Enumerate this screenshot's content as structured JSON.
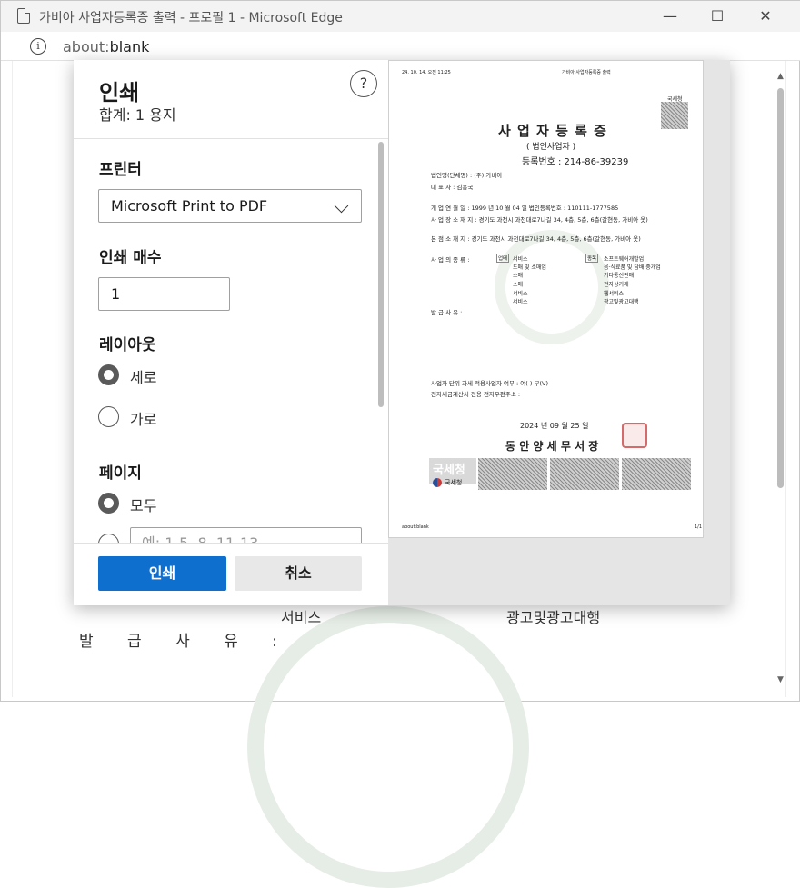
{
  "window": {
    "title": "가비아 사업자등록증 출력 - 프로필 1 - Microsoft Edge",
    "controls": {
      "minimize": "—",
      "maximize": "☐",
      "close": "✕"
    }
  },
  "address_bar": {
    "scheme": "about:",
    "host": "blank"
  },
  "background_page": {
    "cell1": "서비스",
    "cell2": "광고및광고대행",
    "reason_label": "발 급 사 유 :"
  },
  "print_dialog": {
    "title": "인쇄",
    "subtitle": "합계: 1 용지",
    "help": "?",
    "printer_label": "프린터",
    "printer_value": "Microsoft Print to PDF",
    "copies_label": "인쇄 매수",
    "copies_value": "1",
    "layout_label": "레이아웃",
    "layout_options": [
      {
        "label": "세로",
        "selected": true
      },
      {
        "label": "가로",
        "selected": false
      }
    ],
    "pages_label": "페이지",
    "pages_options": [
      {
        "label": "모두",
        "selected": true
      }
    ],
    "pages_placeholder": "예: 1-5, 8, 11-13",
    "print_button": "인쇄",
    "cancel_button": "취소"
  },
  "preview": {
    "header_left": "24. 10. 14. 오전 11:25",
    "header_center": "가비아 사업자등록증 출력",
    "nts_mark": "국세청",
    "doc_title": "사 업 자 등 록 증",
    "doc_subtitle": "( 법인사업자 )",
    "reg_no": "등록번호 : 214-86-39239",
    "rows": [
      "법인명(단체명) : (주) 가비아",
      "대        표        자 : 김홍국",
      "개  업  연  월  일 : 1999 년 10 월 04 일       법인등록번호 : 110111-1777585",
      "사 업 장  소 재 지 : 경기도 과천시 과천대로7나길 34, 4층, 5층, 6층(갈현동, 가비아 옷)",
      "본  점  소  재  지 : 경기도 과천시 과천대로7나길 34, 4층, 5층, 6층(갈현동, 가비아 옷)"
    ],
    "biz_type_label": "사 업 의  종 류 :",
    "biz_tag1": "업태",
    "biz_tag2": "종목",
    "biz_left": [
      "서비스",
      "도매 및 소매업",
      "소매",
      "소매",
      "서비스",
      "서비스"
    ],
    "biz_right": [
      "소프트웨어개발업",
      "음·식료품 및 담배 중개업",
      "기타통신판매",
      "전자상거래",
      "웹서비스",
      "광고및광고대행"
    ],
    "reason_label": "발    급    사    유 :",
    "tax_line1": "사업자 단위 과세 적용사업자 여부 : 여( ) 부(V)",
    "tax_line2": "전자세금계산서 전용 전자우편주소 :",
    "date": "2024 년 09 월 25 일",
    "office": "동 안 양 세 무 서 장",
    "logo_box": "국세청",
    "logo_text": "국세청",
    "footer_left": "about:blank",
    "footer_right": "1/1"
  }
}
